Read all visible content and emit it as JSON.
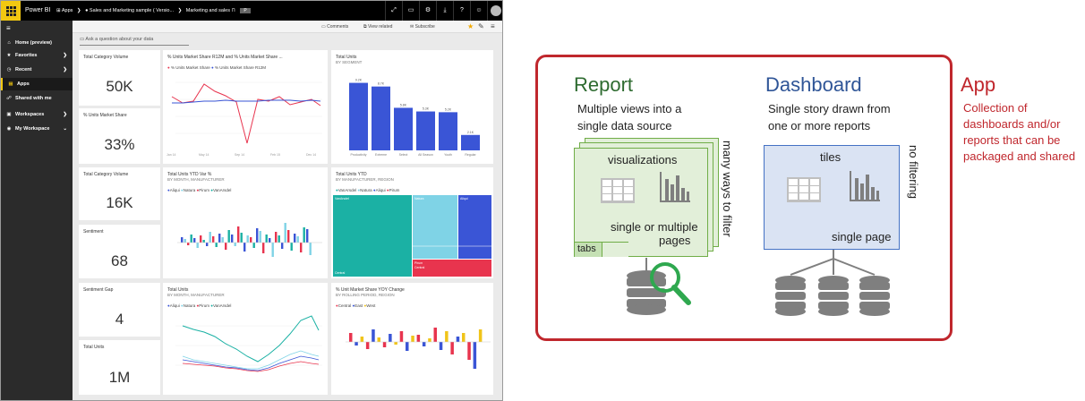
{
  "powerbi": {
    "brand": "Power BI",
    "breadcrumb": [
      "Apps",
      "Sales and Marketing sample ( Versio...",
      "Marketing and sales"
    ],
    "pill": "P",
    "top_icons": [
      "expand-icon",
      "chat-icon",
      "settings-icon",
      "download-icon",
      "help-icon",
      "smiley-icon",
      "avatar-icon"
    ],
    "nav": [
      {
        "label": "Home (preview)",
        "icon": "home-icon",
        "chevron": false
      },
      {
        "label": "Favorites",
        "icon": "star-icon",
        "chevron": true
      },
      {
        "label": "Recent",
        "icon": "clock-icon",
        "chevron": true
      },
      {
        "label": "Apps",
        "icon": "apps-icon",
        "chevron": false,
        "active": true
      },
      {
        "label": "Shared with me",
        "icon": "share-icon",
        "chevron": false
      },
      {
        "label": "Workspaces",
        "icon": "workspaces-icon",
        "chevron": true
      },
      {
        "label": "My Workspace",
        "icon": "user-icon",
        "chevron": true
      }
    ],
    "toolbar": {
      "comments": "Comments",
      "view_related": "View related",
      "subscribe": "Subscribe"
    },
    "qa_placeholder": "Ask a question about your data",
    "cards": [
      {
        "title": "Total Category Volume",
        "value": "50K"
      },
      {
        "title": "% Units Market Share",
        "value": "33%"
      },
      {
        "title": "Total Category Volume",
        "value": "16K"
      },
      {
        "title": "Sentiment",
        "value": "68"
      },
      {
        "title": "Sentiment Gap",
        "value": "4"
      },
      {
        "title": "Total Units",
        "value": "1M"
      }
    ],
    "charts": {
      "share_line": {
        "title": "% Units Market Share R12M and % Units Market Share ...",
        "legend": [
          "% Units Market Share",
          "% Units Market Share R12M"
        ]
      },
      "units_segment": {
        "title": "Total Units",
        "subtitle": "BY SEGMENT",
        "categories": [
          "Productivity",
          "Extreme",
          "Select",
          "All Season",
          "Youth",
          "Regular"
        ],
        "values": [
          9.2,
          8.7,
          5.8,
          5.3,
          5.2,
          2.1
        ],
        "labels": [
          "9.2K",
          "8.7K",
          "5.8K",
          "5.3K",
          "5.2K",
          "2.1K"
        ]
      },
      "ytd_var": {
        "title": "Total Units YTD Var %",
        "subtitle": "BY MONTH, MANUFACTURER",
        "legend": [
          "Aliqui",
          "Natura",
          "Pirum",
          "VanArsdel"
        ]
      },
      "ytd_region": {
        "title": "Total Units YTD",
        "subtitle": "BY MANUFACTURER, REGION",
        "legend": [
          "VanArsdel",
          "Natura",
          "Aliqui",
          "Pirum"
        ],
        "labels": [
          "VanArsdel",
          "Natura",
          "Aliqui",
          "Central",
          "Pirum",
          "Central"
        ]
      },
      "units_month": {
        "title": "Total Units",
        "subtitle": "BY MONTH, MANUFACTURER",
        "legend": [
          "Aliqui",
          "Natura",
          "Pirum",
          "VanArsdel"
        ]
      },
      "share_yoy": {
        "title": "% Unit Market Share YOY Change",
        "subtitle": "BY ROLLING PERIOD, REGION",
        "legend": [
          "Central",
          "East",
          "West"
        ]
      }
    },
    "colors": {
      "yellow": "#f2c811",
      "blue": "#3a55d6",
      "red": "#e8344e",
      "teal": "#1bb1a4",
      "lightblue": "#7fd3e6",
      "green": "#2fa84f",
      "orange": "#f0a300"
    }
  },
  "diagram": {
    "report": {
      "title": "Report",
      "desc": [
        "Multiple views into a",
        "single data source"
      ],
      "card_label": "visualizations",
      "card_bottom": [
        "single or multiple",
        "pages"
      ],
      "tabs": "tabs",
      "side": "many ways to filter"
    },
    "dashboard": {
      "title": "Dashboard",
      "desc": [
        "Single story drawn from",
        "one or more reports"
      ],
      "card_label": "tiles",
      "card_bottom": "single page",
      "side": "no filtering"
    },
    "app": {
      "title": "App",
      "desc": [
        "Collection of",
        "dashboards and/or",
        "reports that can be",
        "packaged and shared"
      ]
    },
    "colors": {
      "app_border": "#c0272d",
      "report_green": "#2e6b30",
      "dashboard_blue": "#2f5597"
    }
  }
}
